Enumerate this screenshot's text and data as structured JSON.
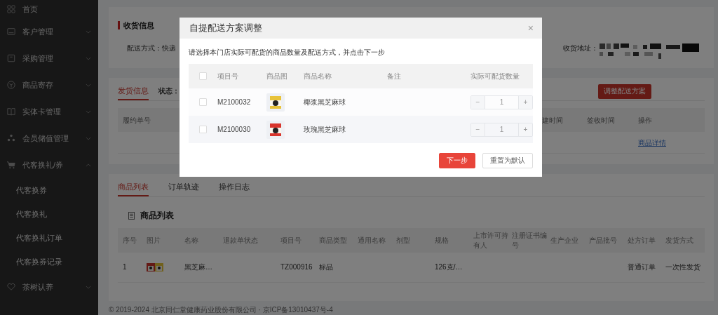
{
  "sidebar": {
    "items": [
      {
        "label": "首页",
        "kind": "link"
      },
      {
        "label": "客户管理",
        "kind": "group",
        "expanded": false
      },
      {
        "label": "采购管理",
        "kind": "group",
        "expanded": false
      },
      {
        "label": "商品寄存",
        "kind": "group",
        "expanded": false
      },
      {
        "label": "实体卡管理",
        "kind": "group",
        "expanded": false
      },
      {
        "label": "会员储值管理",
        "kind": "group",
        "expanded": false
      },
      {
        "label": "代客换礼/券",
        "kind": "group",
        "expanded": true,
        "children": [
          {
            "label": "代客换券"
          },
          {
            "label": "代客换礼"
          },
          {
            "label": "代客换礼订单"
          },
          {
            "label": "代客换券记录"
          }
        ]
      },
      {
        "label": "茶树认养",
        "kind": "group",
        "expanded": false
      }
    ]
  },
  "receiving": {
    "title": "收货信息",
    "delivery": "配送方式：快递",
    "address_label": "收货地址："
  },
  "shipping": {
    "tabs": [
      {
        "label": "发货信息",
        "selected": true
      }
    ],
    "status_label": "状态：",
    "adjust_button": "调整配送方案",
    "columns": [
      {
        "label": "履约单号"
      },
      {
        "label": "建时间"
      },
      {
        "label": "签收时间"
      },
      {
        "label": "操作"
      }
    ],
    "row": {
      "link": "商品详情"
    }
  },
  "products": {
    "tabs": [
      {
        "label": "商品列表",
        "selected": true
      },
      {
        "label": "订单轨迹",
        "selected": false
      },
      {
        "label": "操作日志",
        "selected": false
      }
    ],
    "title": "商品列表",
    "columns": [
      "序号",
      "图片",
      "名称",
      "退款单状态",
      "项目号",
      "商品类型",
      "通用名称",
      "剂型",
      "规格",
      "上市许可持有人",
      "注册证书编号",
      "生产企业",
      "产品批号",
      "处方订单",
      "发货方式"
    ],
    "rows": [
      {
        "cells": [
          {
            "text": "1"
          },
          {
            "kind": "picture"
          },
          {
            "text": "黑芝麻…"
          },
          {},
          {
            "text": "TZ000916"
          },
          {
            "text": "标品"
          },
          {},
          {},
          {
            "text": "126克/…"
          },
          {},
          {},
          {},
          {},
          {
            "text": "普通订单"
          },
          {
            "text": "一次性发货"
          }
        ]
      }
    ]
  },
  "footer": "© 2019-2024 北京同仁堂健康药业股份有限公司 · 京ICP备13010437号-4",
  "modal": {
    "title": "自提配送方案调整",
    "close": "×",
    "instruction": "请选择本门店实际可配货的商品数量及配送方式，并点击下一步",
    "all_checked": false,
    "columns": [
      "项目号",
      "商品图",
      "商品名称",
      "备注",
      "实际可配货数量"
    ],
    "rows": [
      {
        "checked": false,
        "code": "M2100032",
        "image": {
          "kind": "picture",
          "color": "#e8c33a"
        },
        "name": "椰浆黑芝麻球",
        "quantity": "1",
        "minus": "−",
        "plus": "+"
      },
      {
        "checked": false,
        "code": "M2100030",
        "image": {
          "kind": "picture",
          "color": "#d8342c"
        },
        "name": "玫瑰黑芝麻球",
        "quantity": "1",
        "minus": "−",
        "plus": "+"
      }
    ],
    "buttons": [
      {
        "label": "下一步",
        "kind": "primary"
      },
      {
        "label": "重置为默认",
        "kind": "default"
      }
    ]
  }
}
